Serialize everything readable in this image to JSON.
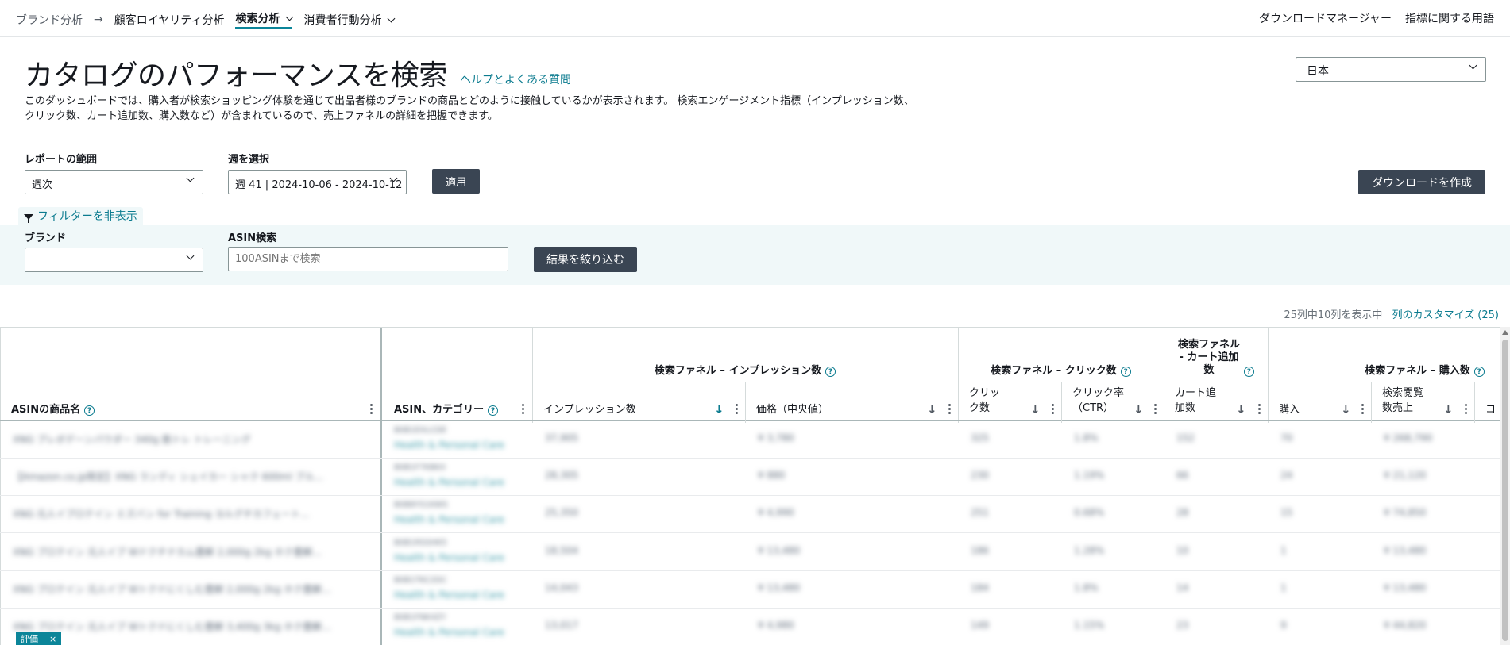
{
  "nav": {
    "breadcrumb_root": "ブランド分析",
    "items": [
      {
        "label": "顧客ロイヤリティ分析"
      },
      {
        "label": "検索分析"
      },
      {
        "label": "消費者行動分析"
      }
    ],
    "right": [
      "ダウンロードマネージャー",
      "指標に関する用語"
    ]
  },
  "header": {
    "title": "カタログのパフォーマンスを検索",
    "help_link": "ヘルプとよくある質問",
    "description": "このダッシュボードでは、購入者が検索ショッピング体験を通じて出品者様のブランドの商品とどのように接触しているかが表示されます。 検索エンゲージメント指標（インプレッション数、クリック数、カート追加数、購入数など）が含まれているので、売上ファネルの詳細を把握できます。",
    "country": "日本"
  },
  "controls": {
    "range_label": "レポートの範囲",
    "range_value": "週次",
    "week_label": "週を選択",
    "week_value": "週 41 | 2024-10-06 - 2024-10-12",
    "apply": "適用",
    "download": "ダウンロードを作成",
    "filter_toggle": "フィルターを非表示",
    "brand_label": "ブランド",
    "brand_value": "",
    "asin_label": "ASIN検索",
    "asin_placeholder": "100ASINまで検索",
    "filter_button": "結果を絞り込む"
  },
  "column_info": {
    "showing": "25列中10列を表示中",
    "customize": "列のカスタマイズ (25)"
  },
  "table": {
    "col_product": "ASINの商品名",
    "col_asin": "ASIN、カテゴリー",
    "groups": [
      "検索ファネル – インプレッション数",
      "検索ファネル – クリック数",
      "検索ファネル - カート追加数",
      "検索ファネル – 購入数"
    ],
    "columns": [
      "インプレッション数",
      "価格（中央値）",
      "クリック数",
      "クリック率（CTR）",
      "カート追加数",
      "購入",
      "検索閲覧数売上",
      "コ"
    ],
    "rows": [
      {
        "product": "XNG プレボデーンパウダー 340g 筋トレ トレーニング",
        "asin": "B0B1EXLCDE",
        "cat": "Health & Personal Care",
        "v": [
          "37,905",
          "¥ 3,780",
          "325",
          "1.8%",
          "152",
          "70",
          "¥ 268,790"
        ]
      },
      {
        "product": "【Amazon.co.jp限定】XNG ランディ シェイカー シャク 600ml ブル...",
        "asin": "B0B1F7KBKX",
        "cat": "Health & Personal Care",
        "v": [
          "28,305",
          "¥ 880",
          "230",
          "1.19%",
          "66",
          "24",
          "¥ 21,120"
        ]
      },
      {
        "product": "XNG 元人イプロテイン ミズバン for Training ヨルグチカフェート...",
        "asin": "B0B8YS1KWS",
        "cat": "Health & Personal Care",
        "v": [
          "25,350",
          "¥ 4,990",
          "251",
          "0.68%",
          "28",
          "15",
          "¥ 74,850"
        ]
      },
      {
        "product": "XNG プロテイン 元人イプ Wドクチナカム豊鮮 2,000g 2kg ホク豊鮮...",
        "asin": "B0B1RSSHK5",
        "cat": "Health & Personal Care",
        "v": [
          "18,504",
          "¥ 13,480",
          "186",
          "1.28%",
          "10",
          "1",
          "¥ 13,480"
        ]
      },
      {
        "product": "XNG プロテイン 元人イプ Wトクドにくしむ豊鮮 2,000g 2kg ホク豊鮮...",
        "asin": "B0B1TKC2DC",
        "cat": "Health & Personal Care",
        "v": [
          "14,043",
          "¥ 13,480",
          "184",
          "1.8%",
          "14",
          "1",
          "¥ 13,480"
        ]
      },
      {
        "product": "XNG プロテイン 元人イプ Wトクドにくしむ豊鮮 3,400g 3kg ホク豊鮮...",
        "asin": "B0B1FNK4ZY",
        "cat": "Health & Personal Care",
        "v": [
          "13,017",
          "¥ 4,980",
          "149",
          "1.15%",
          "23",
          "9",
          "¥ 44,820"
        ]
      }
    ]
  },
  "badge": {
    "label": "評価",
    "close": "×"
  }
}
